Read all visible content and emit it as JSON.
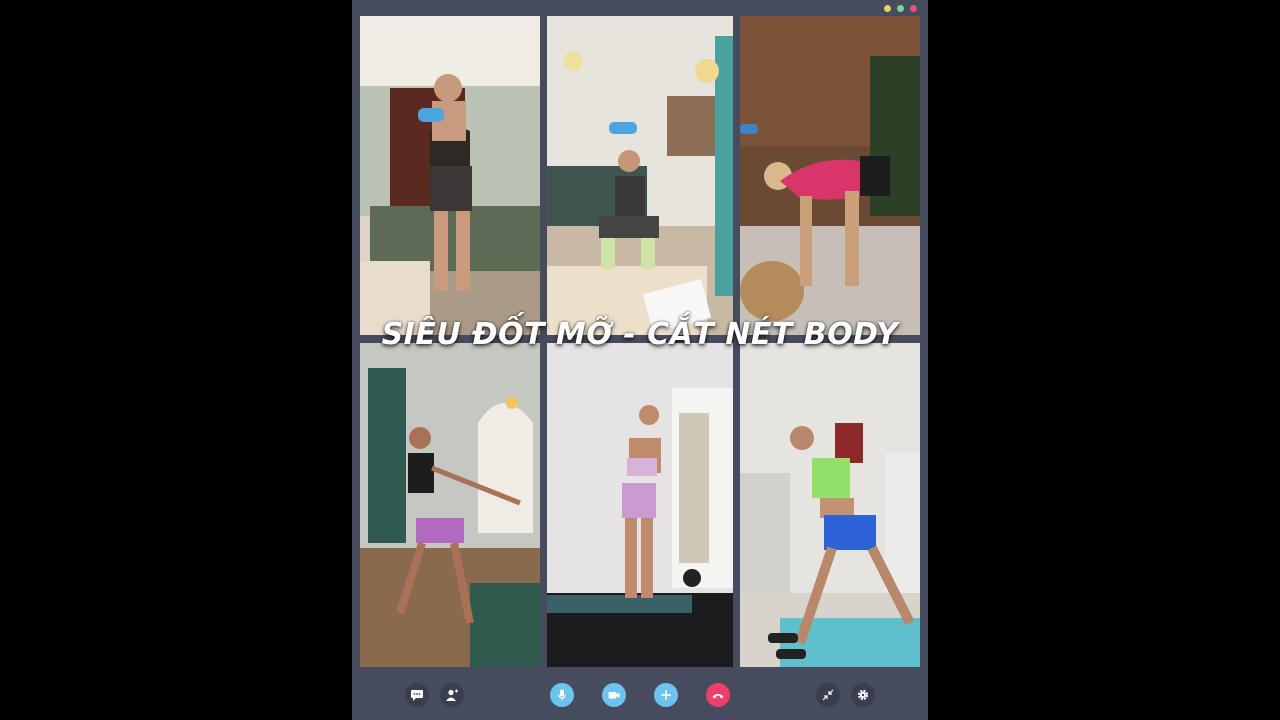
{
  "overlay": {
    "title": "SIÊU ĐỐT MỠ - CẮT NÉT BODY"
  },
  "colors": {
    "app_background": "#474b5e",
    "accent_blue": "#6cc4ee",
    "end_call_red": "#ec3f6a",
    "window_dots": [
      "#e2d36c",
      "#7ed3a0",
      "#e8507a"
    ]
  },
  "participants": [
    {
      "scene": "bedroom, holding blue dumbbell"
    },
    {
      "scene": "living room, overhead dumbbell squat"
    },
    {
      "scene": "wood wall, bent over stretch"
    },
    {
      "scene": "arched doorway, side lunge reach"
    },
    {
      "scene": "wall sit against white wall"
    },
    {
      "scene": "kitchen, lunge with dumbbells"
    }
  ],
  "controls": {
    "left": [
      "chat-icon",
      "add-participant-icon"
    ],
    "center": [
      "microphone-icon",
      "video-camera-icon",
      "plus-icon",
      "end-call-icon"
    ],
    "right": [
      "minimize-icon",
      "gear-icon"
    ]
  }
}
